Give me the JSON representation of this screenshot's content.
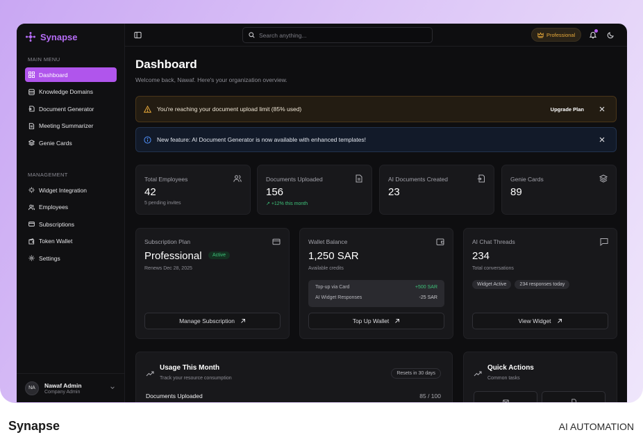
{
  "app": {
    "brand": "Synapse"
  },
  "sidebar": {
    "main_menu_label": "MAIN MENU",
    "main_items": [
      {
        "label": "Dashboard",
        "icon": "grid-icon",
        "active": true
      },
      {
        "label": "Knowledge Domains",
        "icon": "database-icon"
      },
      {
        "label": "Document Generator",
        "icon": "file-export-icon"
      },
      {
        "label": "Meeting Summarizer",
        "icon": "file-text-icon"
      },
      {
        "label": "Genie Cards",
        "icon": "layers-icon"
      }
    ],
    "management_label": "MANAGEMENT",
    "management_items": [
      {
        "label": "Widget Integration",
        "icon": "puzzle-icon"
      },
      {
        "label": "Employees",
        "icon": "users-icon"
      },
      {
        "label": "Subscriptions",
        "icon": "credit-card-icon"
      },
      {
        "label": "Token Wallet",
        "icon": "wallet-icon"
      },
      {
        "label": "Settings",
        "icon": "gear-icon"
      }
    ],
    "user": {
      "initials": "NA",
      "name": "Nawaf Admin",
      "role": "Company Admin"
    }
  },
  "topbar": {
    "search_placeholder": "Search anything...",
    "plan_label": "Professional"
  },
  "page": {
    "title": "Dashboard",
    "subtitle": "Welcome back, Nawaf. Here's your organization overview."
  },
  "alerts": {
    "warning": {
      "text": "You're reaching your document upload limit (85% used)",
      "action": "Upgrade Plan"
    },
    "info": {
      "text": "New feature: AI Document Generator is now available with enhanced templates!"
    }
  },
  "stats": [
    {
      "label": "Total Employees",
      "value": "42",
      "sub": "5 pending invites",
      "icon": "users-icon"
    },
    {
      "label": "Documents Uploaded",
      "value": "156",
      "sub": "+12% this month",
      "icon": "file-icon"
    },
    {
      "label": "AI Documents Created",
      "value": "23",
      "sub": "",
      "icon": "file-export-icon"
    },
    {
      "label": "Genie Cards",
      "value": "89",
      "sub": "",
      "icon": "layers-icon"
    }
  ],
  "cards": {
    "subscription": {
      "label": "Subscription Plan",
      "plan": "Professional",
      "status": "Active",
      "renews": "Renews Dec 28, 2025",
      "button": "Manage Subscription"
    },
    "wallet": {
      "label": "Wallet Balance",
      "balance": "1,250 SAR",
      "sub": "Available credits",
      "rows": [
        {
          "label": "Top-up via Card",
          "amount": "+500 SAR"
        },
        {
          "label": "AI Widget Responses",
          "amount": "-25 SAR"
        }
      ],
      "button": "Top Up Wallet"
    },
    "chat": {
      "label": "AI Chat Threads",
      "value": "234",
      "sub": "Total conversations",
      "chips": [
        "Widget Active",
        "234 responses today"
      ],
      "button": "View Widget"
    }
  },
  "usage": {
    "title": "Usage This Month",
    "subtitle": "Track your resource consumption",
    "resets": "Resets in 30 days",
    "row": {
      "label": "Documents Uploaded",
      "count": "85 / 100"
    }
  },
  "quick_actions": {
    "title": "Quick Actions",
    "subtitle": "Common tasks"
  },
  "footer": {
    "brand": "Synapse",
    "tagline": "AI AUTOMATION"
  },
  "colors": {
    "accent": "#b055ec",
    "warning": "#e6a83a",
    "success": "#3ec27a",
    "info": "#4f8ff7"
  }
}
